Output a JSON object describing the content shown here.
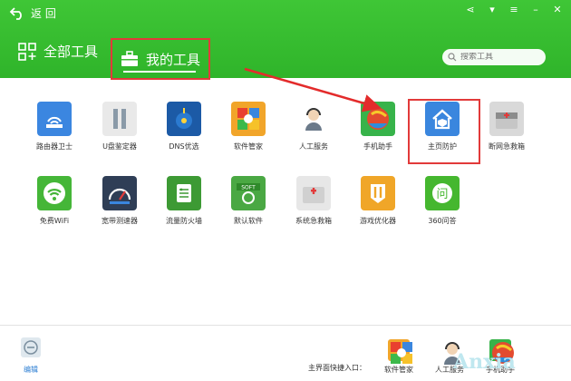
{
  "header": {
    "back_label": "返 回",
    "tab_all": "全部工具",
    "tab_mine": "我的工具",
    "search_placeholder": "搜索工具"
  },
  "tools": [
    {
      "label": "路由器卫士",
      "icon": "router-icon",
      "color": "#3b86e0"
    },
    {
      "label": "U盘鉴定器",
      "icon": "usb-icon",
      "color": "#e9e9e9"
    },
    {
      "label": "DNS优选",
      "icon": "globe-icon",
      "color": "#1c5aa6"
    },
    {
      "label": "软件管家",
      "icon": "software-manager-icon",
      "color": "#f1a52a"
    },
    {
      "label": "人工服务",
      "icon": "support-agent-icon",
      "color": "#ffffff"
    },
    {
      "label": "手机助手",
      "icon": "phone-assistant-icon",
      "color": "#37b34a"
    },
    {
      "label": "主页防护",
      "icon": "home-shield-icon",
      "color": "#3a86de"
    },
    {
      "label": "断网急救箱",
      "icon": "first-aid-box-icon",
      "color": "#d9d9d9"
    },
    {
      "label": "免费WiFi",
      "icon": "wifi-icon",
      "color": "#45b638"
    },
    {
      "label": "宽带测速器",
      "icon": "speedometer-icon",
      "color": "#2f3e56"
    },
    {
      "label": "流量防火墙",
      "icon": "firewall-icon",
      "color": "#3d9a34"
    },
    {
      "label": "默认软件",
      "icon": "soft-icon",
      "color": "#4aa843"
    },
    {
      "label": "系统急救箱",
      "icon": "system-aid-icon",
      "color": "#e7e7e7"
    },
    {
      "label": "游戏优化器",
      "icon": "game-optimizer-icon",
      "color": "#f0a628"
    },
    {
      "label": "360问答",
      "icon": "qa-icon",
      "color": "#45b72f"
    }
  ],
  "bottom": {
    "edit_label": "编辑",
    "quick_label": "主界面快捷入口：",
    "quick": [
      {
        "label": "软件管家",
        "icon": "software-manager-icon"
      },
      {
        "label": "人工服务",
        "icon": "support-agent-icon"
      },
      {
        "label": "手机助手",
        "icon": "phone-assistant-icon"
      }
    ],
    "watermark": "Anxia"
  }
}
